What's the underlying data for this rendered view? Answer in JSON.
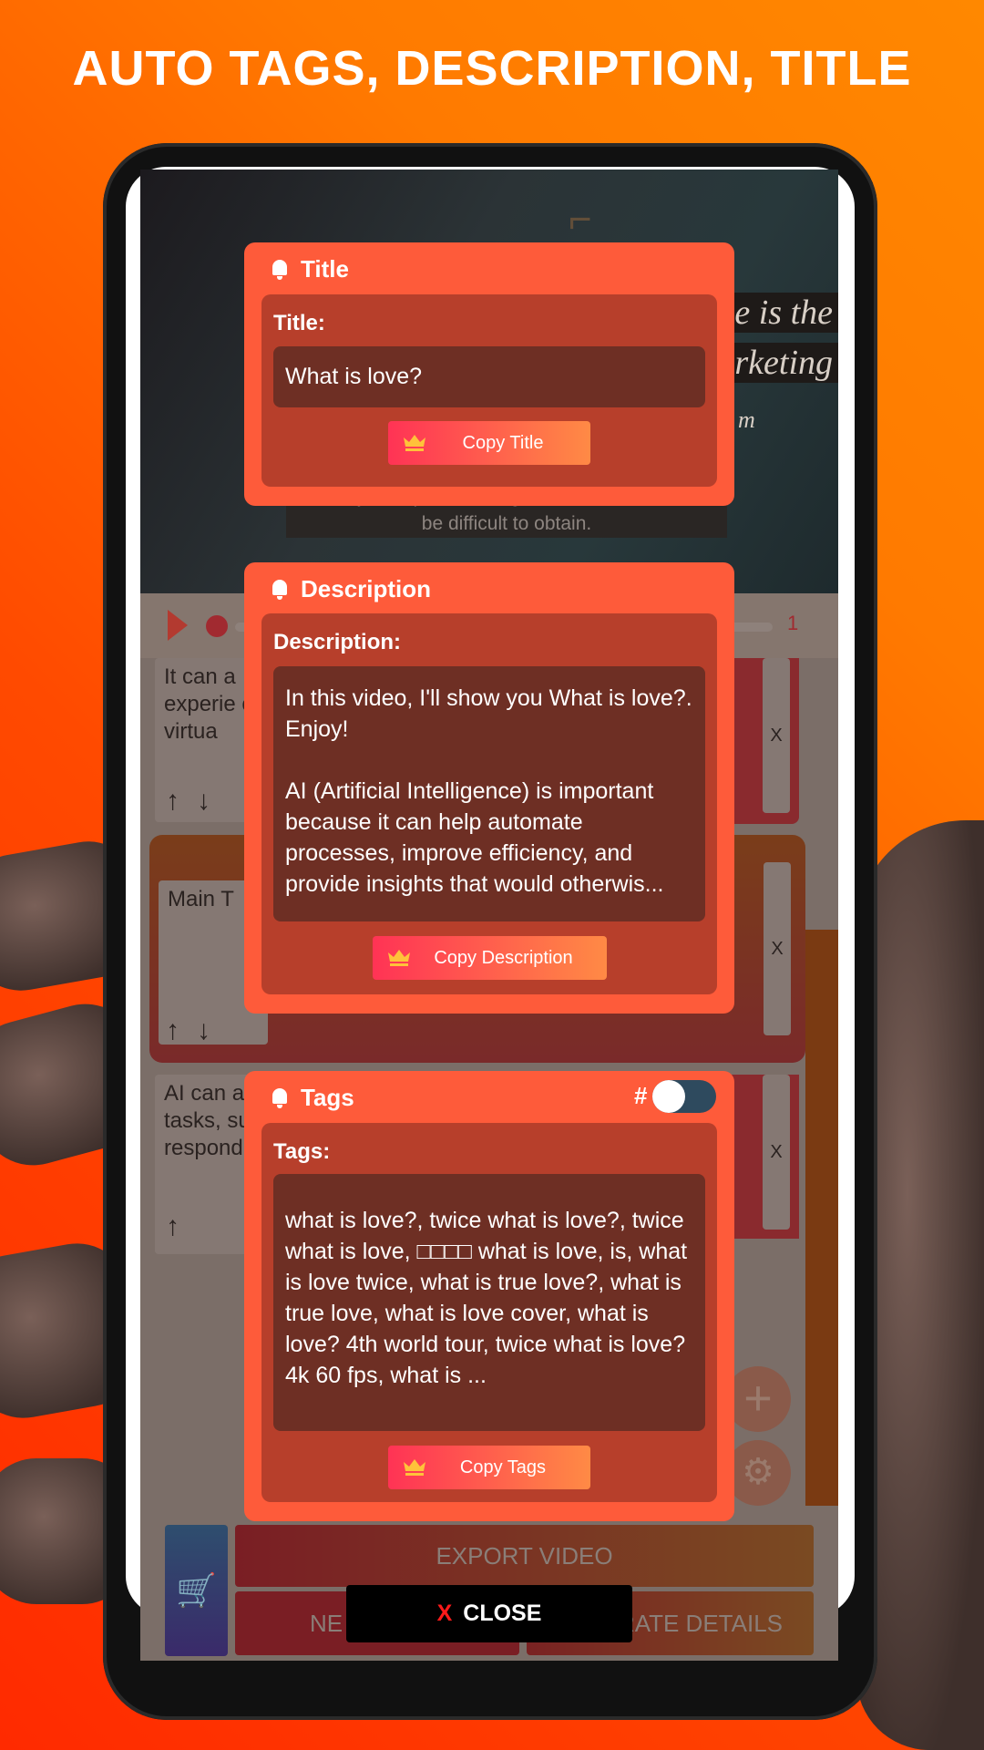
{
  "headline": "AUTO TAGS, DESCRIPTION, TITLE",
  "colors": {
    "card": "#fe5b3a",
    "inner": "#b73f2b",
    "field": "#6e2f24",
    "copy_start": "#ff3355",
    "copy_end": "#ff8a45",
    "close_x": "#ff1a1a"
  },
  "background_app": {
    "video_texts": [
      "e is the",
      "arketing",
      "m"
    ],
    "caption": "efficiency, and provide insights that would otherwise be difficult to obtain.",
    "timeline_count": "1",
    "scenes": [
      {
        "text": " It can a experie of virtua",
        "close": "X"
      },
      {
        "text": " Main T",
        "close": "X"
      },
      {
        "text": " AI can a tasks, su respond",
        "close": "X"
      }
    ],
    "export_label": "EXPORT VIDEO",
    "new_label_fragment": "NE",
    "generate_label_fragment": "RATE DETAILS"
  },
  "title_card": {
    "header": "Title",
    "label": "Title:",
    "value": "What is love?",
    "copy_label": "Copy Title"
  },
  "description_card": {
    "header": "Description",
    "label": "Description:",
    "value": "In this video, I'll show you What is love?. Enjoy!\n\n AI (Artificial Intelligence) is important because it can help automate processes, improve efficiency, and provide insights that would otherwis...",
    "copy_label": "Copy Description"
  },
  "tags_card": {
    "header": "Tags",
    "hash_label": "#",
    "hashtag_toggle_on": false,
    "label": "Tags:",
    "value": "what is love?, twice what is love?, twice what is love, □□□□ what is love, is, what is love twice, what is true love?, what is true love, what is love cover, what is love? 4th world tour, twice what is love? 4k 60 fps, what is ...",
    "copy_label": "Copy Tags"
  },
  "close_button": {
    "x": "X",
    "label": "CLOSE"
  }
}
